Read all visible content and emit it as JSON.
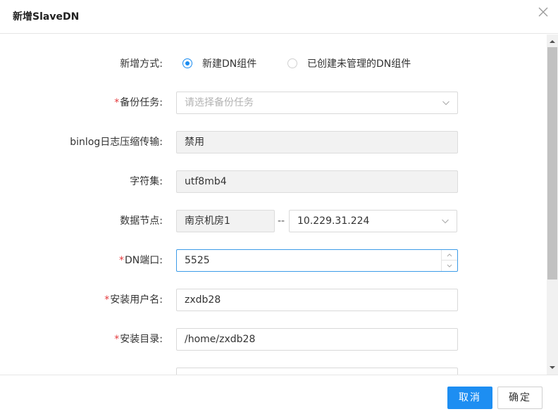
{
  "dialog": {
    "title": "新增SlaveDN"
  },
  "form": {
    "add_mode": {
      "label": "新增方式:",
      "options": [
        "新建DN组件",
        "已创建未管理的DN组件"
      ],
      "selected": "新建DN组件"
    },
    "backup_task": {
      "label": "备份任务:",
      "required": true,
      "placeholder": "请选择备份任务"
    },
    "binlog_compress": {
      "label": "binlog日志压缩传输:",
      "value": "禁用"
    },
    "charset": {
      "label": "字符集:",
      "value": "utf8mb4"
    },
    "data_node": {
      "label": "数据节点:",
      "room": "南京机房1",
      "separator": "--",
      "ip": "10.229.31.224"
    },
    "dn_port": {
      "label": "DN端口:",
      "required": true,
      "value": "5525"
    },
    "install_user": {
      "label": "安装用户名:",
      "required": true,
      "value": "zxdb28"
    },
    "install_dir": {
      "label": "安装目录:",
      "required": true,
      "value": "/home/zxdb28"
    }
  },
  "footer": {
    "cancel_label": "取消",
    "confirm_label": "确定"
  },
  "colors": {
    "primary": "#1d8ef2",
    "required": "#e4393c",
    "focus_border": "#3d9ce8"
  },
  "icons": [
    "close-icon",
    "chevron-down-icon",
    "stepper-up-icon",
    "stepper-down-icon",
    "scroll-up-icon",
    "scroll-down-icon"
  ]
}
